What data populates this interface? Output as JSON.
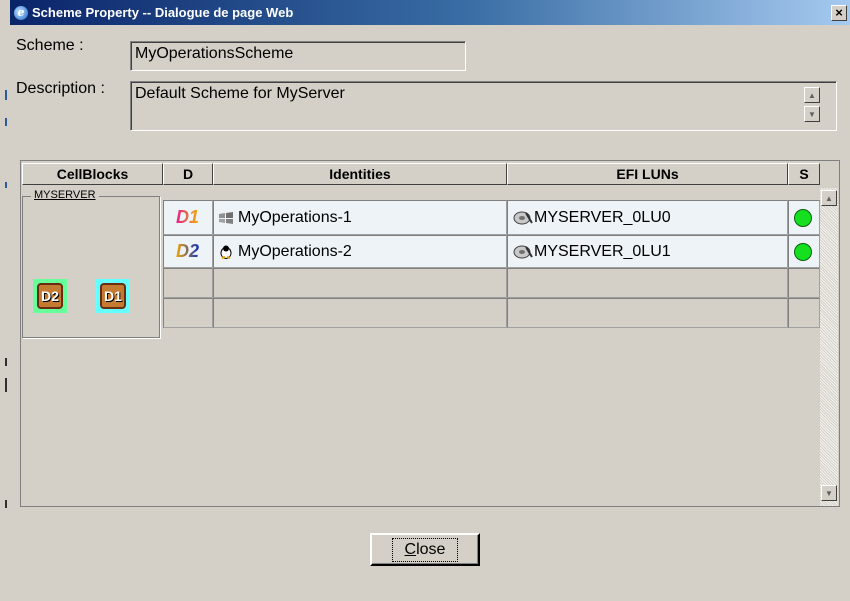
{
  "window": {
    "title": "Scheme Property -- Dialogue de page Web",
    "close_glyph": "×"
  },
  "form": {
    "scheme_label": "Scheme :",
    "scheme_value": "MyOperationsScheme",
    "description_label": "Description :",
    "description_value": "Default Scheme for MyServer"
  },
  "table": {
    "headers": [
      "CellBlocks",
      "D",
      "Identities",
      "EFI LUNs",
      "S"
    ],
    "group_label": "MYSERVER",
    "cell_block_icons": [
      {
        "label": "D2",
        "icon": "cellblock-d2-icon",
        "bg": "#66ff99"
      },
      {
        "label": "D1",
        "icon": "cellblock-d1-icon",
        "bg": "#66ffff"
      }
    ],
    "rows": [
      {
        "d": "D1",
        "os_icon": "windows-icon",
        "identity": "MyOperations-1",
        "lun": "MYSERVER_0LU0",
        "status_color": "#14e020"
      },
      {
        "d": "D2",
        "os_icon": "linux-icon",
        "identity": "MyOperations-2",
        "lun": "MYSERVER_0LU1",
        "status_color": "#14e020"
      }
    ]
  },
  "buttons": {
    "close_label_underlined": "C",
    "close_label_rest": "lose"
  }
}
